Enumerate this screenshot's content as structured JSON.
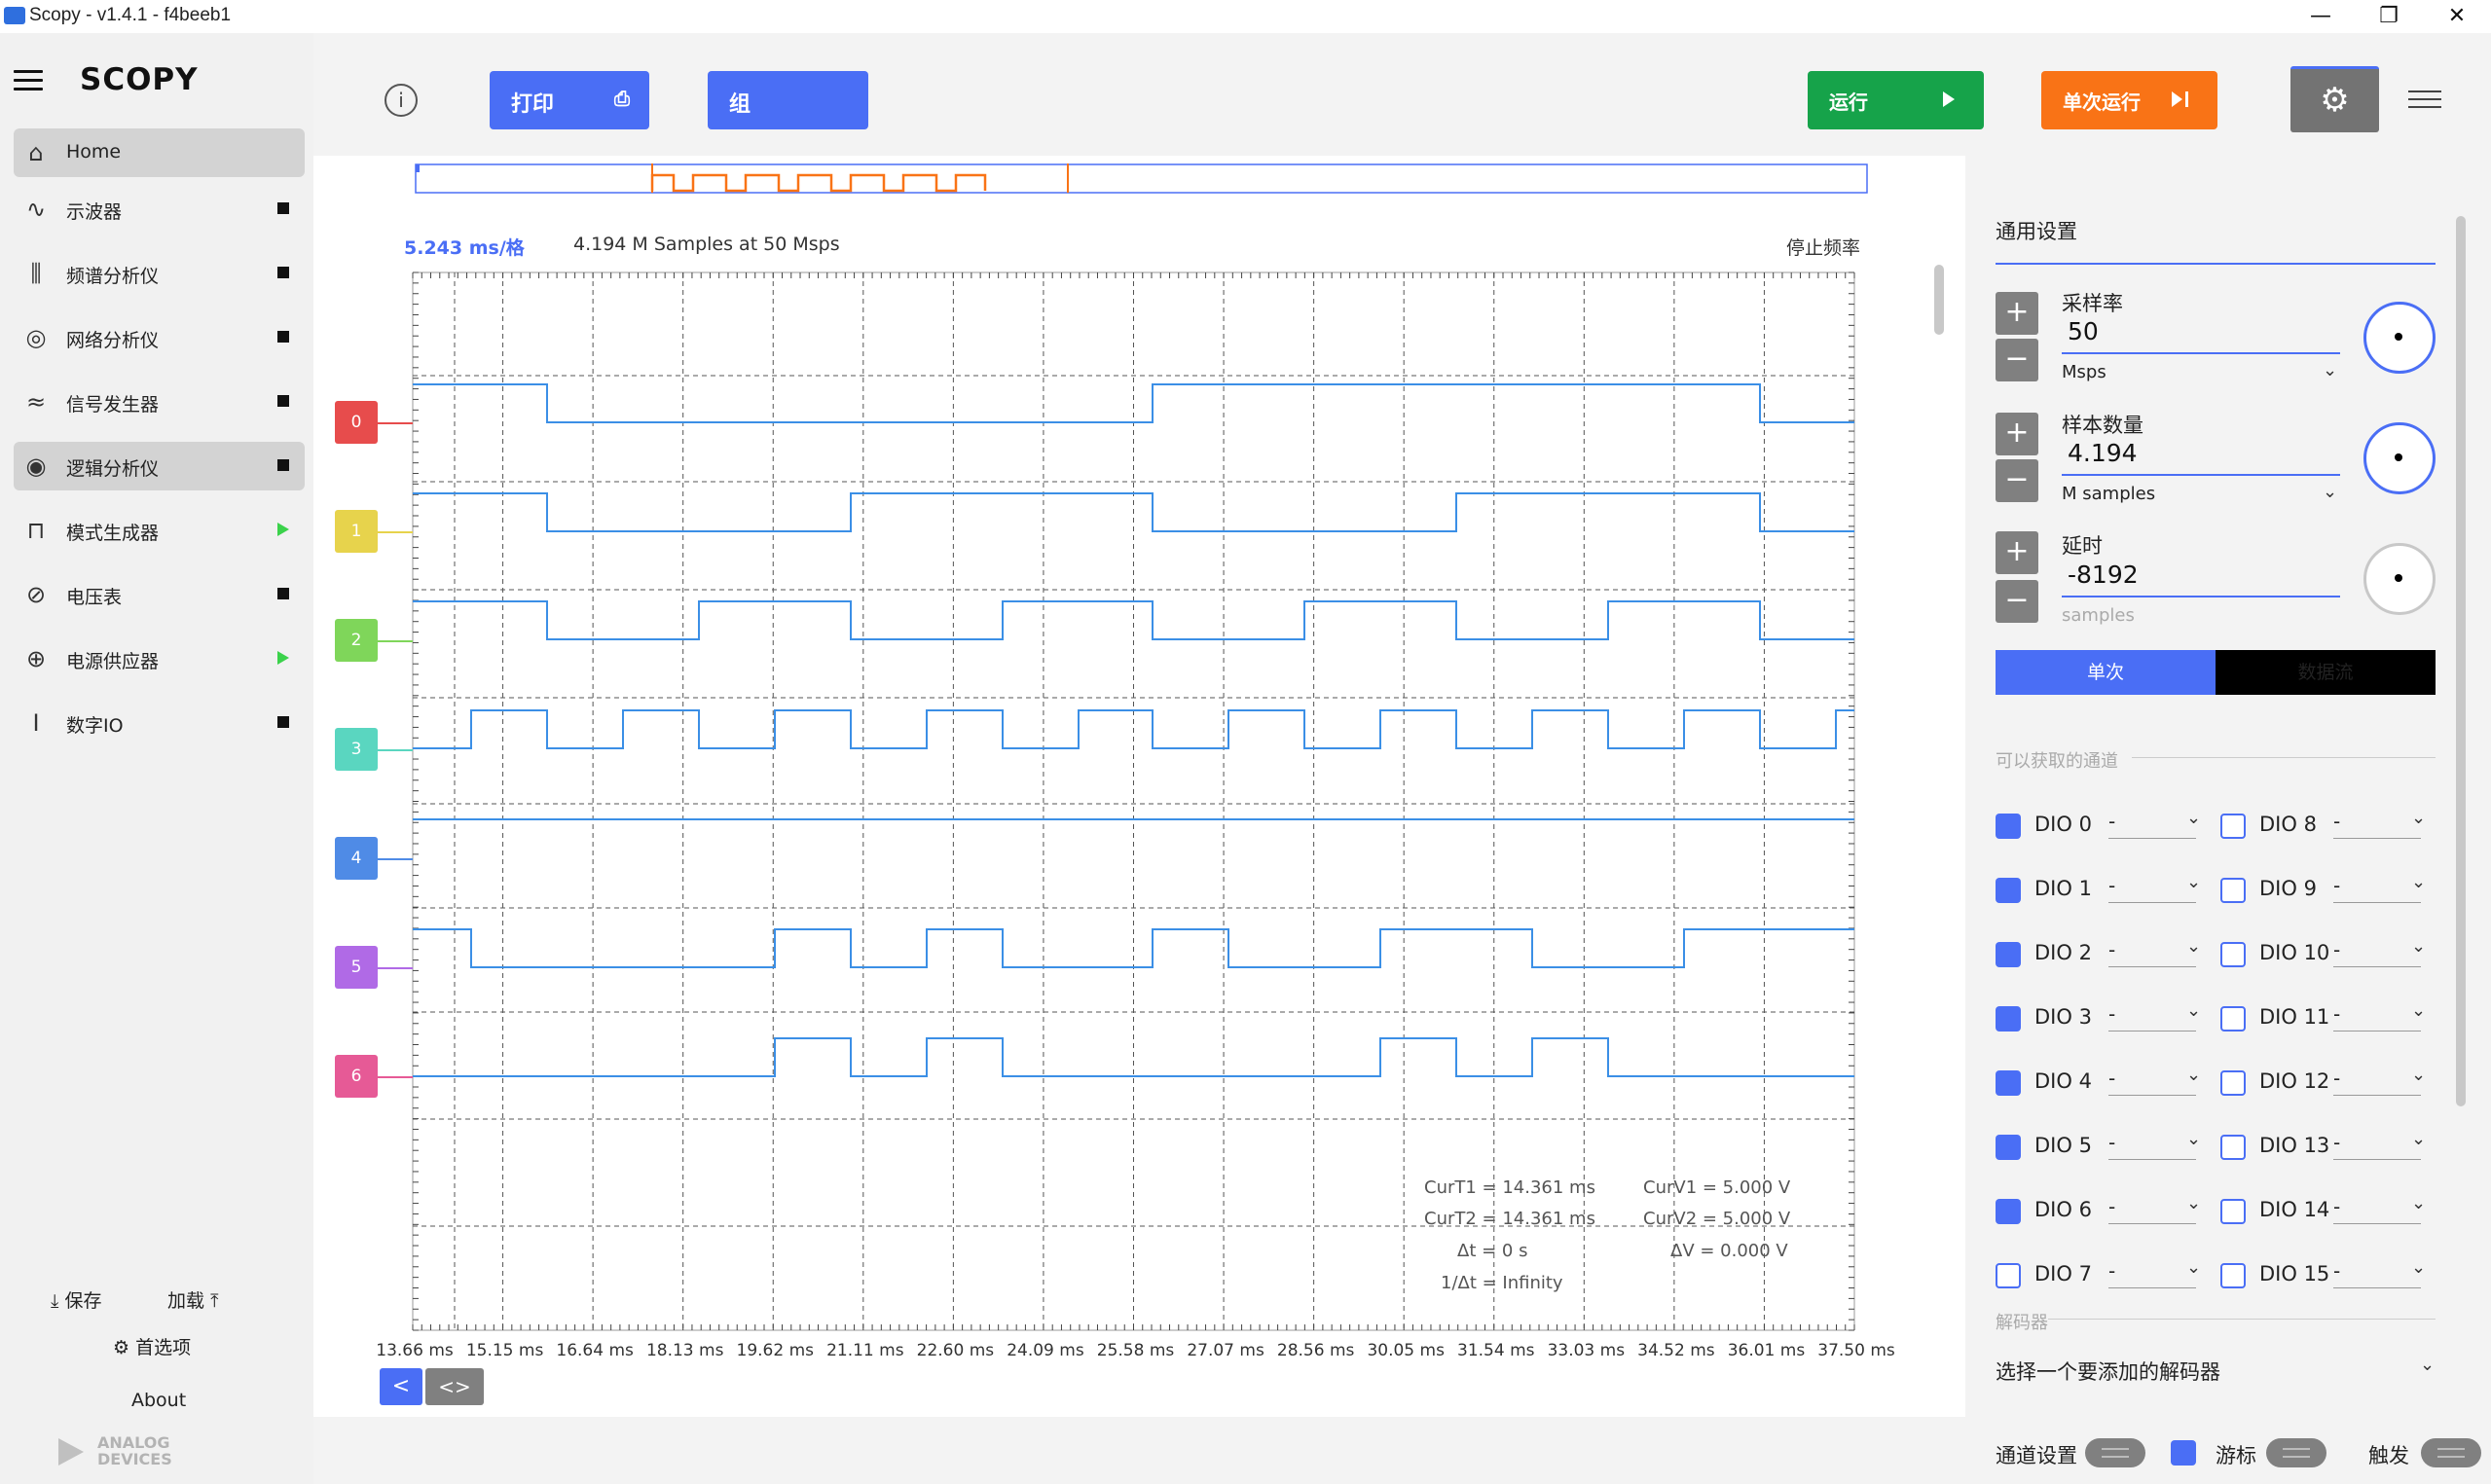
{
  "window": {
    "title": "Scopy - v1.4.1 - f4beeb1",
    "minimize": "—",
    "restore": "❐",
    "close": "✕"
  },
  "brand": {
    "name": "SCOPY"
  },
  "nav": [
    {
      "label": "Home",
      "icon": "home-icon",
      "status": "none"
    },
    {
      "label": "示波器",
      "icon": "oscilloscope-icon",
      "status": "stop"
    },
    {
      "label": "频谱分析仪",
      "icon": "spectrum-icon",
      "status": "stop"
    },
    {
      "label": "网络分析仪",
      "icon": "network-icon",
      "status": "stop"
    },
    {
      "label": "信号发生器",
      "icon": "signal-icon",
      "status": "stop"
    },
    {
      "label": "逻辑分析仪",
      "icon": "logic-icon",
      "status": "stop"
    },
    {
      "label": "模式生成器",
      "icon": "pattern-icon",
      "status": "play"
    },
    {
      "label": "电压表",
      "icon": "voltmeter-icon",
      "status": "stop"
    },
    {
      "label": "电源供应器",
      "icon": "power-icon",
      "status": "play"
    },
    {
      "label": "数字IO",
      "icon": "dio-icon",
      "status": "stop"
    }
  ],
  "footer": {
    "save": "保存",
    "load": "加载",
    "prefs": "首选项",
    "about": "About",
    "vendor_line1": "ANALOG",
    "vendor_line2": "DEVICES"
  },
  "toolbar": {
    "print": "打印",
    "group": "组",
    "run": "运行",
    "single": "单次运行",
    "colors": {
      "blue": "#4a6ef5",
      "green": "#16a34a",
      "orange": "#f97316",
      "gray": "#737373"
    }
  },
  "plot": {
    "timebase": "5.243 ms/格",
    "samples_info": "4.194 M Samples at 50 Msps",
    "status": "停止频率",
    "x_ticks": [
      "13.66 ms",
      "15.15 ms",
      "16.64 ms",
      "18.13 ms",
      "19.62 ms",
      "21.11 ms",
      "22.60 ms",
      "24.09 ms",
      "25.58 ms",
      "27.07 ms",
      "28.56 ms",
      "30.05 ms",
      "31.54 ms",
      "33.03 ms",
      "34.52 ms",
      "36.01 ms",
      "37.50 ms"
    ],
    "channels": [
      {
        "label": "0",
        "color": "#e74c4c"
      },
      {
        "label": "1",
        "color": "#e7d34c"
      },
      {
        "label": "2",
        "color": "#7fd65a"
      },
      {
        "label": "3",
        "color": "#5ad6c0"
      },
      {
        "label": "4",
        "color": "#4f8be6"
      },
      {
        "label": "5",
        "color": "#b06ae6"
      },
      {
        "label": "6",
        "color": "#e65a96"
      }
    ],
    "cursor_readout": {
      "curT1": "CurT1 = 14.361 ms",
      "curT2": "CurT2 = 14.361 ms",
      "dt": "Δt = 0 s",
      "inv_dt": "1/Δt = Infinity",
      "curV1": "CurV1 = 5.000 V",
      "curV2": "CurV2 = 5.000 V",
      "dv": "ΔV = 0.000 V"
    },
    "nav_left": "<",
    "nav_both": "<>"
  },
  "panel": {
    "title": "通用设置",
    "sample_rate": {
      "label": "采样率",
      "value": "50",
      "unit": "Msps"
    },
    "sample_count": {
      "label": "样本数量",
      "value": "4.194",
      "unit": "M samples"
    },
    "delay": {
      "label": "延时",
      "value": "-8192",
      "unit": "samples"
    },
    "mode_single": "单次",
    "mode_stream": "数据流",
    "channels_title": "可以获取的通道",
    "dio_left": [
      {
        "name": "DIO 0",
        "checked": true,
        "value": "-"
      },
      {
        "name": "DIO 1",
        "checked": true,
        "value": "-"
      },
      {
        "name": "DIO 2",
        "checked": true,
        "value": "-"
      },
      {
        "name": "DIO 3",
        "checked": true,
        "value": "-"
      },
      {
        "name": "DIO 4",
        "checked": true,
        "value": "-"
      },
      {
        "name": "DIO 5",
        "checked": true,
        "value": "-"
      },
      {
        "name": "DIO 6",
        "checked": true,
        "value": "-"
      },
      {
        "name": "DIO 7",
        "checked": false,
        "value": "-"
      }
    ],
    "dio_right": [
      {
        "name": "DIO 8",
        "checked": false,
        "value": "-"
      },
      {
        "name": "DIO 9",
        "checked": false,
        "value": "-"
      },
      {
        "name": "DIO 10",
        "checked": false,
        "value": "-"
      },
      {
        "name": "DIO 11",
        "checked": false,
        "value": "-"
      },
      {
        "name": "DIO 12",
        "checked": false,
        "value": "-"
      },
      {
        "name": "DIO 13",
        "checked": false,
        "value": "-"
      },
      {
        "name": "DIO 14",
        "checked": false,
        "value": "-"
      },
      {
        "name": "DIO 15",
        "checked": false,
        "value": "-"
      }
    ],
    "decoder_title": "解码器",
    "decoder_select": "选择一个要添加的解码器"
  },
  "bottom": {
    "channel_settings": "通道设置",
    "cursors": "游标",
    "trigger": "触发"
  }
}
